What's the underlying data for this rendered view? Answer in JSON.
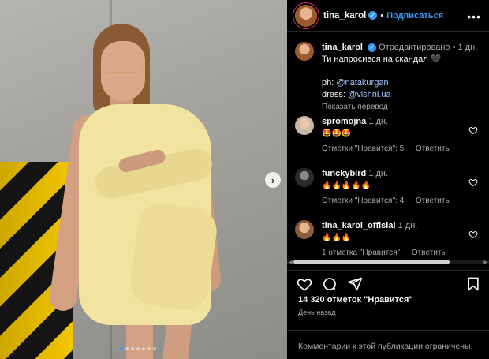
{
  "post": {
    "author": "tina_karol",
    "follow_label": "Подписаться",
    "more_label": "•••",
    "photo_alt": "Фото публикации",
    "carousel_count": 7,
    "carousel_active": 0
  },
  "caption": {
    "username": "tina_karol",
    "edited_label": "Отредактировано",
    "time": "1 дн.",
    "text": "Ти напросився на скандал 🖤",
    "ph_label": "ph:",
    "ph_mention": "@natakurgan",
    "dress_label": "dress:",
    "dress_mention": "@vishni.ua",
    "translate_label": "Показать перевод"
  },
  "comments": [
    {
      "username": "spromojna",
      "time": "1 дн.",
      "text": "🤩🤩🤩",
      "likes_label": "Отметки \"Нравится\": 5",
      "reply_label": "Ответить"
    },
    {
      "username": "funckybird",
      "time": "1 дн.",
      "text": "🔥🔥🔥🔥🔥",
      "likes_label": "Отметки \"Нравится\": 4",
      "reply_label": "Ответить"
    },
    {
      "username": "tina_karol_offisial",
      "time": "1 дн.",
      "text": "🔥🔥🔥",
      "likes_label": "1 отметка \"Нравится\"",
      "reply_label": "Ответить"
    }
  ],
  "stats": {
    "likes_text": "14 320 отметок \"Нравится\"",
    "date_text": "День назад"
  },
  "footer": {
    "comments_limited": "Комментарии к этой публикации ограничены."
  },
  "colors": {
    "accent": "#3897f0",
    "background": "#000000",
    "muted": "#a8a8a8"
  },
  "icons": [
    "heart-icon",
    "comment-icon",
    "share-icon",
    "bookmark-icon",
    "more-icon",
    "chevron-right-icon",
    "verified-icon"
  ]
}
